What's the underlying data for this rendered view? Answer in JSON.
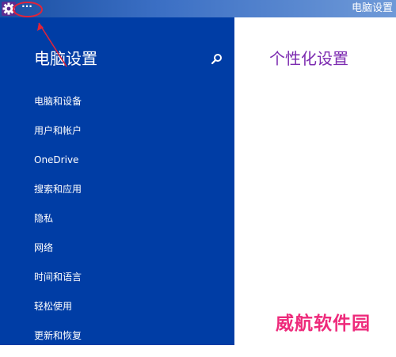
{
  "titlebar": {
    "title": "电脑设置",
    "more_label": "···",
    "icons": {
      "app": "gear-icon"
    },
    "colors": {
      "bar_start": "#1a4fa3",
      "bar_end": "#6f9ad8",
      "app_icon_bg": "#5c2d91"
    }
  },
  "sidebar": {
    "title": "电脑设置",
    "search_icon": "search-icon",
    "background": "#003da5",
    "items": [
      {
        "label": "电脑和设备"
      },
      {
        "label": "用户和帐户"
      },
      {
        "label": "OneDrive"
      },
      {
        "label": "搜索和应用"
      },
      {
        "label": "隐私"
      },
      {
        "label": "网络"
      },
      {
        "label": "时间和语言"
      },
      {
        "label": "轻松使用"
      },
      {
        "label": "更新和恢复"
      }
    ]
  },
  "content": {
    "title": "个性化设置",
    "title_color": "#7c2bb0"
  },
  "annotation": {
    "color": "#e0243a",
    "shapes": "red-ellipse-and-arrow"
  },
  "watermark": {
    "text": "威航软件园",
    "color": "#ee2a7b"
  }
}
